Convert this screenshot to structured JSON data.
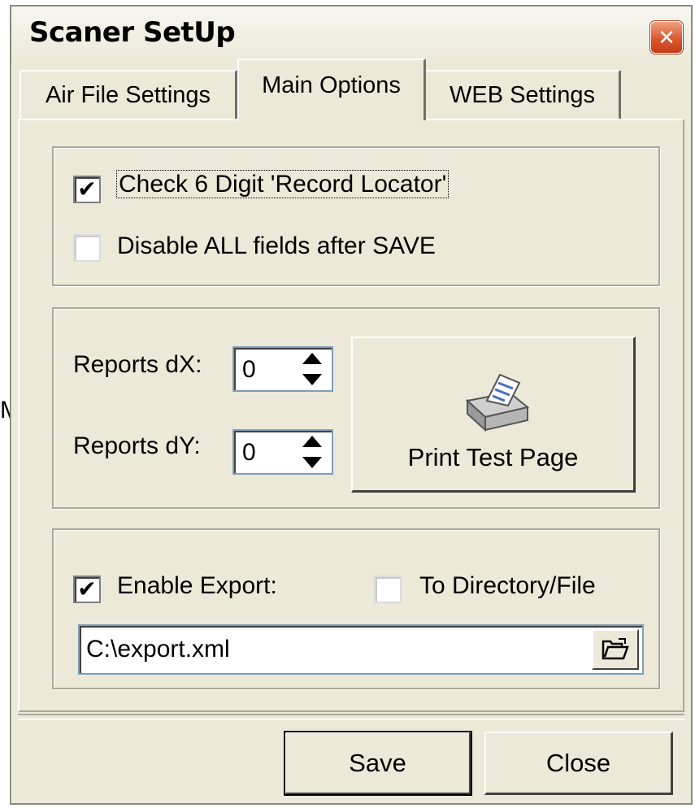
{
  "stray_glyph": "M",
  "window": {
    "title": "Scaner SetUp",
    "close_glyph": "✕"
  },
  "tabs": [
    {
      "label": "Air File Settings",
      "active": false
    },
    {
      "label": "Main Options",
      "active": true
    },
    {
      "label": "WEB Settings",
      "active": false
    }
  ],
  "options": {
    "check_record_locator": {
      "label": "Check 6 Digit 'Record Locator'",
      "checked": true
    },
    "disable_fields": {
      "label": "Disable ALL fields after SAVE",
      "checked": false
    }
  },
  "reports": {
    "dx_label": "Reports dX:",
    "dx_value": "0",
    "dy_label": "Reports dY:",
    "dy_value": "0",
    "print_button": "Print Test Page",
    "print_icon": "printer-icon"
  },
  "export": {
    "enable_label": "Enable Export:",
    "enable_checked": true,
    "to_dir_label": "To Directory/File",
    "to_dir_checked": false,
    "path_value": "C:\\export.xml",
    "browse_icon": "open-folder-icon"
  },
  "footer": {
    "save_label": "Save",
    "close_label": "Close"
  },
  "colors": {
    "dialog_bg": "#ece9d8",
    "close_red": "#d9582f",
    "field_border": "#7f9db9"
  },
  "check_glyph": "✔"
}
